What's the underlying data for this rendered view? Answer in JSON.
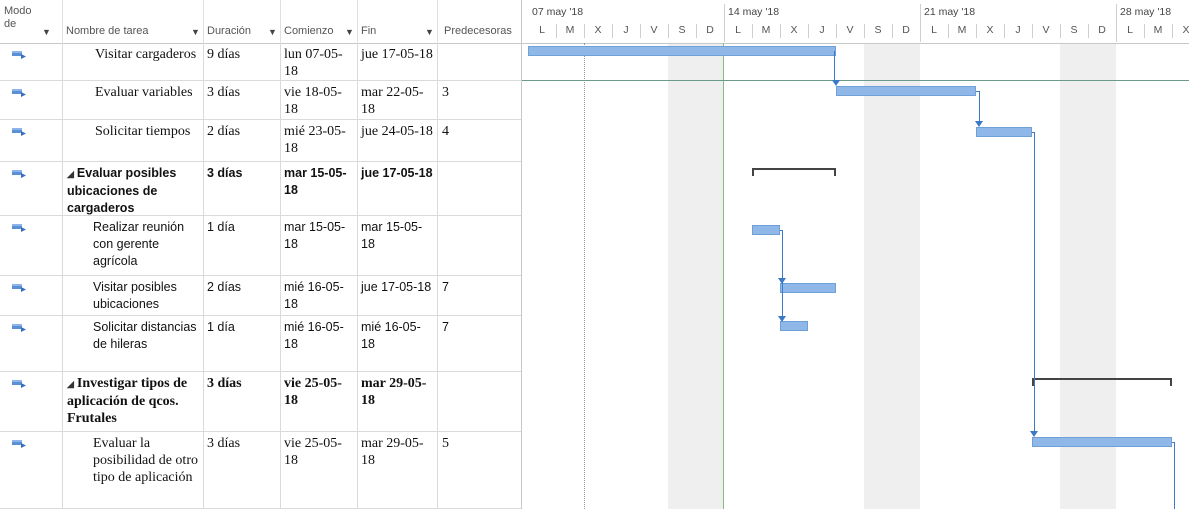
{
  "columns": {
    "mode": "Modo de",
    "name": "Nombre de tarea",
    "duration": "Duración",
    "start": "Comienzo",
    "finish": "Fin",
    "predecessors": "Predecesoras"
  },
  "timescale": {
    "weeks": [
      "07 may '18",
      "14 may '18",
      "21 may '18",
      "28 may '18"
    ],
    "days": [
      "L",
      "M",
      "X",
      "J",
      "V",
      "S",
      "D",
      "L",
      "M",
      "X",
      "J",
      "V",
      "S",
      "D",
      "L",
      "M",
      "X",
      "J",
      "V",
      "S",
      "D",
      "L",
      "M",
      "X"
    ]
  },
  "tasks": [
    {
      "name": "Visitar cargaderos",
      "duration": "9 días",
      "start": "lun 07-05-18",
      "finish": "jue 17-05-18",
      "pred": "",
      "style": "serif"
    },
    {
      "name": "Evaluar variables",
      "duration": "3 días",
      "start": "vie 18-05-18",
      "finish": "mar 22-05-18",
      "pred": "3",
      "style": "serif"
    },
    {
      "name": "Solicitar tiempos",
      "duration": "2 días",
      "start": "mié 23-05-18",
      "finish": "jue 24-05-18",
      "pred": "4",
      "style": "serif"
    },
    {
      "name": "Evaluar posibles ubicaciones de cargaderos",
      "duration": "3 días",
      "start": "mar 15-05-18",
      "finish": "jue 17-05-18",
      "pred": "",
      "style": "sans-bold",
      "summary": true
    },
    {
      "name": "Realizar reunión con gerente agrícola",
      "duration": "1 día",
      "start": "mar 15-05-18",
      "finish": "mar 15-05-18",
      "pred": "",
      "style": "sans"
    },
    {
      "name": "Visitar posibles ubicaciones",
      "duration": "2 días",
      "start": "mié 16-05-18",
      "finish": "jue 17-05-18",
      "pred": "7",
      "style": "sans"
    },
    {
      "name": "Solicitar distancias de hileras",
      "duration": "1 día",
      "start": "mié 16-05-18",
      "finish": "mié 16-05-18",
      "pred": "7",
      "style": "sans"
    },
    {
      "name": "Investigar tipos de aplicación de qcos. Frutales",
      "duration": "3 días",
      "start": "vie 25-05-18",
      "finish": "mar 29-05-18",
      "pred": "",
      "style": "serif-bold",
      "summary": true
    },
    {
      "name": "Evaluar la posibilidad de otro tipo de aplicación",
      "duration": "3 días",
      "start": "vie 25-05-18",
      "finish": "mar 29-05-18",
      "pred": "5",
      "style": "serif"
    }
  ],
  "colors": {
    "bar": "#8fb8e8",
    "link": "#3a78c8",
    "summary": "#444444",
    "weekend": "#efefef"
  }
}
